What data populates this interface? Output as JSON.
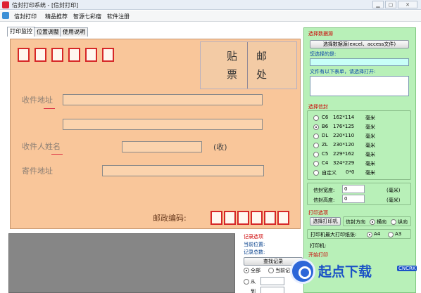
{
  "window": {
    "title": "信封打印系统 - [信封打印]"
  },
  "menu": {
    "items": [
      "信封打印",
      "精品推荐",
      "智源七彩瘤",
      "软件注册"
    ]
  },
  "tabs": [
    "打印监控",
    "位置调整",
    "使用说明"
  ],
  "envelope": {
    "stamp_chars": [
      "贴",
      "票"
    ],
    "post_chars": [
      "邮",
      "处"
    ],
    "recipient_address_label": "收件地址",
    "recipient_name_label": "收件人姓名",
    "recipient_suffix": "(收)",
    "sender_address_label": "寄件地址",
    "postcode_label": "邮政编码:",
    "top_zip_boxes": 6,
    "bottom_zip_boxes": 6
  },
  "records": {
    "title": "记录选项",
    "current_position_label": "当前位置:",
    "total_label": "记录总数:",
    "search_button": "查找记录",
    "option_all": "全部",
    "option_current": "当前记",
    "option_from": "从",
    "option_to": "到"
  },
  "right_panel": {
    "data_source": {
      "title": "选择数据源",
      "button": "选择数据源(excel、access文件)",
      "selected_label": "您选择的是:",
      "selected_value": "",
      "tables_label": "文件有以下表单，请选择打开:"
    },
    "envelope_select": {
      "title": "选择信封",
      "options": [
        {
          "name": "C6",
          "size": "162*114",
          "unit": "毫米",
          "selected": false
        },
        {
          "name": "B6",
          "size": "176*125",
          "unit": "毫米",
          "selected": true
        },
        {
          "name": "DL",
          "size": "220*110",
          "unit": "毫米",
          "selected": false
        },
        {
          "name": "ZL",
          "size": "230*120",
          "unit": "毫米",
          "selected": false
        },
        {
          "name": "C5",
          "size": "229*162",
          "unit": "毫米",
          "selected": false
        },
        {
          "name": "C4",
          "size": "324*229",
          "unit": "毫米",
          "selected": false
        },
        {
          "name": "自定义",
          "size": "0*0",
          "unit": "毫米",
          "selected": false
        }
      ],
      "width_label": "信封宽度:",
      "width_value": "0",
      "height_label": "信封高度:",
      "height_value": "0",
      "unit_label": "(毫米)"
    },
    "print_options": {
      "title": "打印选项",
      "select_printer_button": "选择打印机",
      "direction_label": "信封方向",
      "direction_options": [
        "横向",
        "纵向"
      ],
      "max_paper_label": "打印机最大打印纸张:",
      "paper_options": [
        "A4",
        "A3"
      ],
      "printer_label": "打印机:"
    },
    "start_print_title": "开始打印"
  },
  "watermark": {
    "text": "起点下载",
    "badge": "CNCRK"
  },
  "colors": {
    "envelope": "#f9c69a",
    "panel": "#b8f0b8",
    "zip_border": "#d62727",
    "section_title": "#cc0000"
  },
  "icons": [
    "app-icon",
    "minimize-icon",
    "restore-icon",
    "close-icon",
    "print-menu-icon",
    "logo-icon"
  ]
}
